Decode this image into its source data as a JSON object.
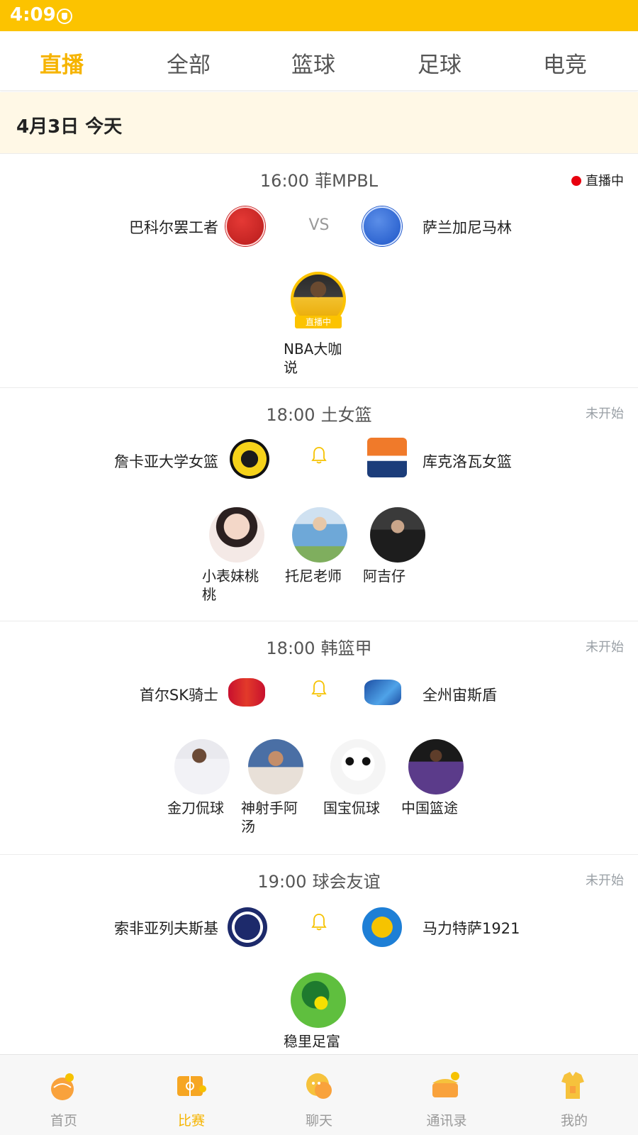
{
  "status_bar": {
    "time": "4:09"
  },
  "tabs": [
    {
      "label": "直播",
      "active": true
    },
    {
      "label": "全部",
      "active": false
    },
    {
      "label": "篮球",
      "active": false
    },
    {
      "label": "足球",
      "active": false
    },
    {
      "label": "电竞",
      "active": false
    }
  ],
  "date_header": "4月3日  今天",
  "colors": {
    "accent": "#fcc300",
    "active_text": "#f6b400",
    "live_dot": "#e8000e",
    "date_bg": "#fff8e6"
  },
  "matches": [
    {
      "time": "16:00",
      "league": "菲MPBL",
      "status": "直播中",
      "is_live": true,
      "home": "巴科尔罢工者",
      "away": "萨兰加尼马林",
      "vs": "VS",
      "hosts": [
        {
          "name": "NBA大咖说",
          "live_badge": "直播中"
        }
      ]
    },
    {
      "time": "18:00",
      "league": "土女篮",
      "status": "未开始",
      "is_live": false,
      "home": "詹卡亚大学女篮",
      "away": "库克洛瓦女篮",
      "hosts": [
        {
          "name": "小表妹桃桃"
        },
        {
          "name": "托尼老师"
        },
        {
          "name": "阿吉仔"
        }
      ]
    },
    {
      "time": "18:00",
      "league": "韩篮甲",
      "status": "未开始",
      "is_live": false,
      "home": "首尔SK骑士",
      "away": "全州宙斯盾",
      "hosts": [
        {
          "name": "金刀侃球"
        },
        {
          "name": "神射手阿汤"
        },
        {
          "name": "国宝侃球"
        },
        {
          "name": "中国篮途"
        }
      ]
    },
    {
      "time": "19:00",
      "league": "球会友谊",
      "status": "未开始",
      "is_live": false,
      "home": "索非亚列夫斯基",
      "away": "马力特萨1921",
      "hosts": [
        {
          "name": "稳里足富"
        }
      ]
    }
  ],
  "bottom_nav": [
    {
      "label": "首页",
      "icon": "home-icon",
      "active": false
    },
    {
      "label": "比赛",
      "icon": "match-icon",
      "active": true
    },
    {
      "label": "聊天",
      "icon": "chat-icon",
      "active": false
    },
    {
      "label": "通讯录",
      "icon": "contacts-icon",
      "active": false
    },
    {
      "label": "我的",
      "icon": "profile-icon",
      "active": false
    }
  ]
}
